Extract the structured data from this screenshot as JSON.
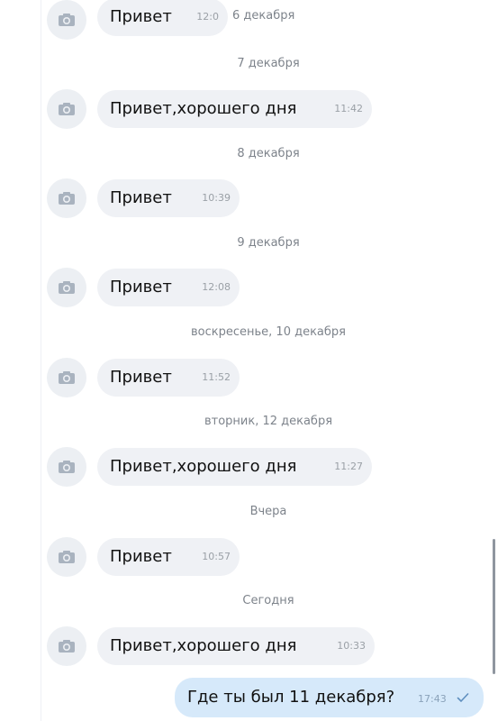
{
  "messages": [
    {
      "text": "Привет",
      "time": "12:0",
      "avatar_icon": "camera-icon"
    },
    {
      "text": "Привет,хорошего дня",
      "time": "11:42",
      "avatar_icon": "camera-icon"
    },
    {
      "text": "Привет",
      "time": "10:39",
      "avatar_icon": "camera-icon"
    },
    {
      "text": "Привет",
      "time": "12:08",
      "avatar_icon": "camera-icon"
    },
    {
      "text": "Привет",
      "time": "11:52",
      "avatar_icon": "camera-icon"
    },
    {
      "text": "Привет,хорошего дня",
      "time": "11:27",
      "avatar_icon": "camera-icon"
    },
    {
      "text": "Привет",
      "time": "10:57",
      "avatar_icon": "camera-icon"
    },
    {
      "text": "Привет,хорошего дня",
      "time": "10:33",
      "avatar_icon": "camera-icon"
    }
  ],
  "date_separators": [
    "6 декабря",
    "7 декабря",
    "8 декабря",
    "9 декабря",
    "воскресенье, 10 декабря",
    "вторник, 12 декабря",
    "Вчера",
    "Сегодня"
  ],
  "outgoing": {
    "text": "Где ты был 11 декабря?",
    "time": "17:43",
    "status_icon": "check-icon"
  },
  "colors": {
    "incoming_bubble": "#eff1f5",
    "outgoing_bubble": "#d6e9fa",
    "date_text": "#7d838b"
  }
}
